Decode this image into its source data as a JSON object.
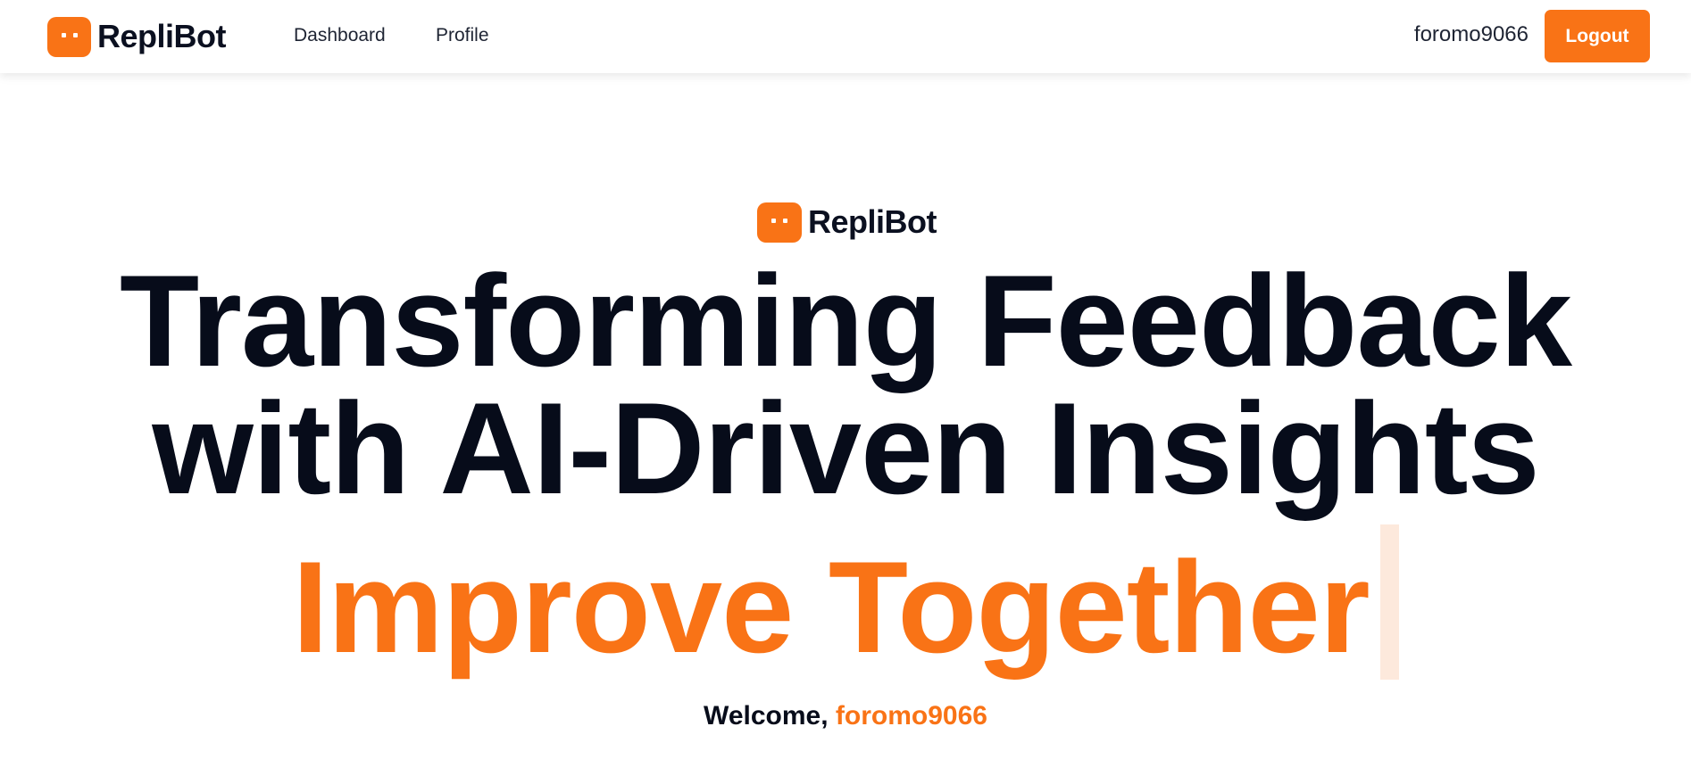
{
  "navbar": {
    "brand": "RepliBot",
    "links": [
      {
        "label": "Dashboard"
      },
      {
        "label": "Profile"
      }
    ],
    "username": "foromo9066",
    "logout_label": "Logout"
  },
  "hero": {
    "brand": "RepliBot",
    "headline_line1": "Transforming Feedback",
    "headline_line2": "with AI-Driven Insights",
    "tagline": "Improve Together",
    "welcome_prefix": "Welcome,",
    "welcome_user": "foromo9066"
  },
  "colors": {
    "accent": "#f97316",
    "text_dark": "#070c1a",
    "cursor_bar": "#fde9dc"
  },
  "icons": {
    "brand_icon": "chat-bot-icon"
  }
}
